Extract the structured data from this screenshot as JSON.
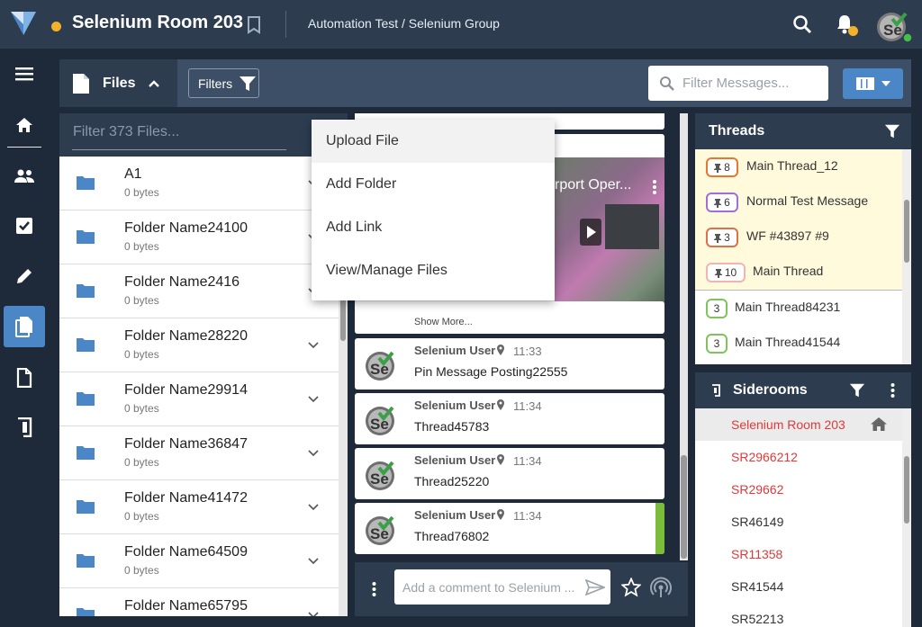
{
  "header": {
    "room_title": "Selenium Room 203",
    "breadcrumb": "Automation Test / Selenium Group",
    "status_color": "#f0b32a",
    "avatar_text": "Se"
  },
  "nav": {
    "items": [
      "menu-icon",
      "home-icon",
      "people-icon",
      "tasks-icon",
      "pencil-icon",
      "files-icon",
      "document-icon",
      "sideroom-icon"
    ],
    "active": "files-icon",
    "accent_color": "#4b86c6"
  },
  "toolbar": {
    "files_label": "Files",
    "filters_label": "Filters",
    "filter_messages_placeholder": "Filter Messages..."
  },
  "files": {
    "filter_placeholder": "Filter 373 Files...",
    "items": [
      {
        "name": "A1",
        "size": "0 bytes"
      },
      {
        "name": "Folder Name24100",
        "size": "0 bytes"
      },
      {
        "name": "Folder Name2416",
        "size": "0 bytes"
      },
      {
        "name": "Folder Name28220",
        "size": "0 bytes"
      },
      {
        "name": "Folder Name29914",
        "size": "0 bytes"
      },
      {
        "name": "Folder Name36847",
        "size": "0 bytes"
      },
      {
        "name": "Folder Name41472",
        "size": "0 bytes"
      },
      {
        "name": "Folder Name64509",
        "size": "0 bytes"
      },
      {
        "name": "Folder Name65795",
        "size": ""
      }
    ]
  },
  "dropdown": {
    "items": [
      "Upload File",
      "Add Folder",
      "Add Link",
      "View/Manage Files"
    ]
  },
  "messages": {
    "video_title": "rport Oper...",
    "show_more": "Show More...",
    "items": [
      {
        "user": "Selenium User",
        "time": "11:33",
        "text": "Pin Message Posting22555"
      },
      {
        "user": "Selenium User",
        "time": "11:34",
        "text": "Thread45783"
      },
      {
        "user": "Selenium User",
        "time": "11:34",
        "text": "Thread25220"
      },
      {
        "user": "Selenium User",
        "time": "11:34",
        "text": "Thread76802"
      }
    ],
    "comment_placeholder": "Add a comment to Selenium ..."
  },
  "threads": {
    "title": "Threads",
    "pinned": [
      {
        "count": "8",
        "label": "Main Thread_12",
        "color": "#e8772e"
      },
      {
        "count": "6",
        "label": "Normal Test Message",
        "color": "#a66bd6"
      },
      {
        "count": "3",
        "label": "WF #43897 #9",
        "color": "#e0704a"
      },
      {
        "count": "10",
        "label": "Main Thread",
        "color": "#f2b4b0"
      }
    ],
    "items": [
      {
        "count": "3",
        "label": "Main Thread84231",
        "color": "#7fc45a"
      },
      {
        "count": "3",
        "label": "Main Thread41544",
        "color": "#7fc45a"
      }
    ]
  },
  "siderooms": {
    "title": "Siderooms",
    "items": [
      {
        "label": "Selenium Room 203",
        "color": "red"
      },
      {
        "label": "SR2966212",
        "color": "red"
      },
      {
        "label": "SR29662",
        "color": "red"
      },
      {
        "label": "SR46149",
        "color": "dark"
      },
      {
        "label": "SR11358",
        "color": "red"
      },
      {
        "label": "SR41544",
        "color": "dark"
      },
      {
        "label": "SR52213",
        "color": "dark"
      }
    ]
  }
}
